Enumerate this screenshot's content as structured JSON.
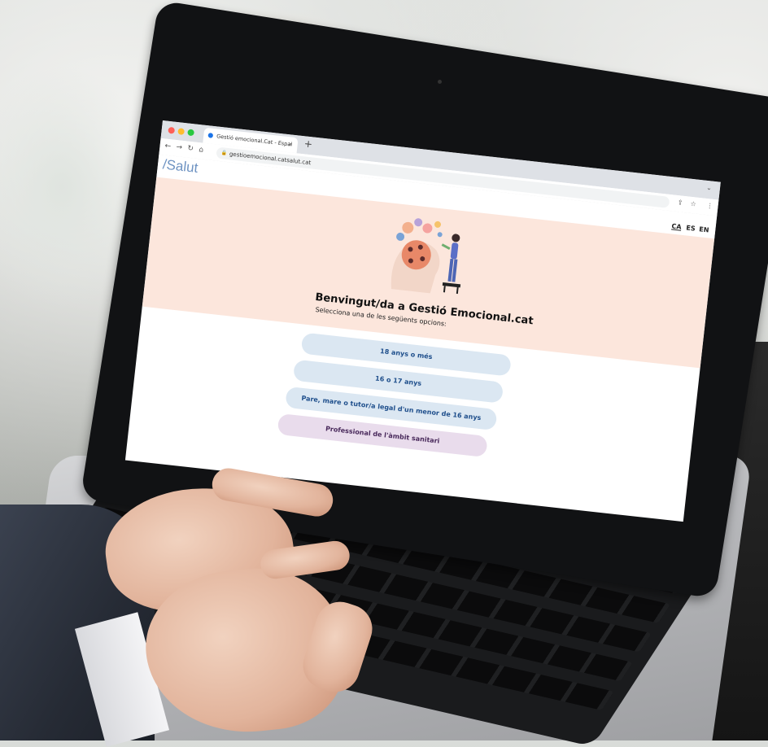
{
  "browser": {
    "tab_title": "Gestió emocional.Cat - Espai",
    "tab_close": "×",
    "new_tab": "+",
    "url": "gestioemocional.catsalut.cat"
  },
  "site": {
    "logo": "/Salut",
    "languages": [
      "CA",
      "ES",
      "EN"
    ],
    "active_language": "CA",
    "title": "Benvingut/da a Gestió Emocional.cat",
    "subtitle": "Selecciona una de les següents opcions:",
    "options": [
      "18 anys o més",
      "16 o 17 anys",
      "Pare, mare o tutor/a legal d'un menor de 16 anys",
      "Professional de l'àmbit sanitari"
    ]
  },
  "colors": {
    "hero_bg": "#fce6dc",
    "option_blue": "#dbe7f2",
    "option_purple": "#e9dcec",
    "logo": "#6e93c2"
  },
  "icons": [
    "back-icon",
    "forward-icon",
    "reload-icon",
    "home-icon",
    "lock-icon",
    "share-icon",
    "star-icon",
    "menu-icon",
    "tab-favicon-icon"
  ]
}
